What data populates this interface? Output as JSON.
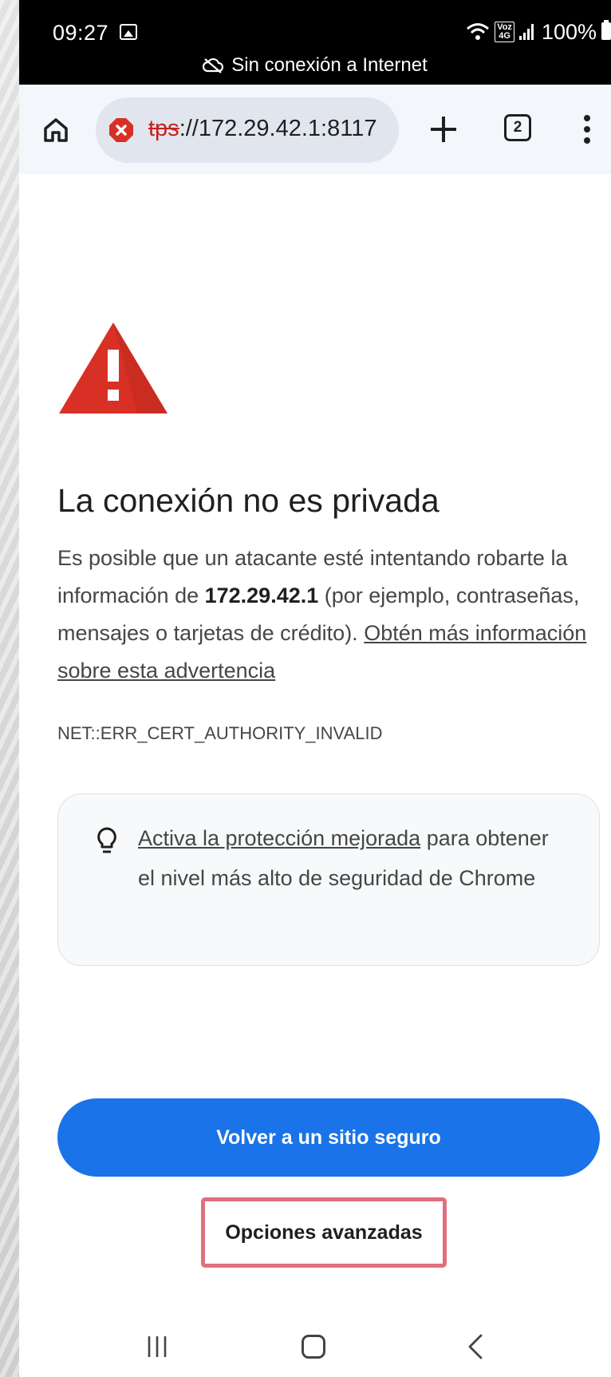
{
  "status_bar": {
    "time": "09:27",
    "network_badge": "Voz\n4G",
    "battery": "100%",
    "offline_notice": "Sin conexión a Internet"
  },
  "toolbar": {
    "url_prefix_struck": "tps",
    "url_rest": "://172.29.42.1:8117",
    "tab_count": "2"
  },
  "page": {
    "heading": "La conexión no es privada",
    "body_before_host": "Es posible que un atacante esté intentando robarte la información de ",
    "host": "172.29.42.1",
    "body_after_host": " (por ejemplo, contraseñas, mensajes o tarjetas de crédito). ",
    "learn_more_link": "Obtén más información sobre esta advertencia",
    "error_code": "NET::ERR_CERT_AUTHORITY_INVALID",
    "card_link": "Activa la protección mejorada",
    "card_text": " para obtener el nivel más alto de seguridad de Chrome",
    "primary_button": "Volver a un sitio seguro",
    "advanced_button": "Opciones avanzadas"
  },
  "colors": {
    "primary": "#1a73e8",
    "warning_red": "#d93025",
    "highlight": "#e0707f"
  },
  "icons": [
    "home-icon",
    "insecure-icon",
    "new-tab-icon",
    "tab-switcher-icon",
    "more-menu-icon",
    "warning-triangle-icon",
    "lightbulb-icon",
    "recent-apps-icon",
    "nav-home-icon",
    "nav-back-icon"
  ]
}
